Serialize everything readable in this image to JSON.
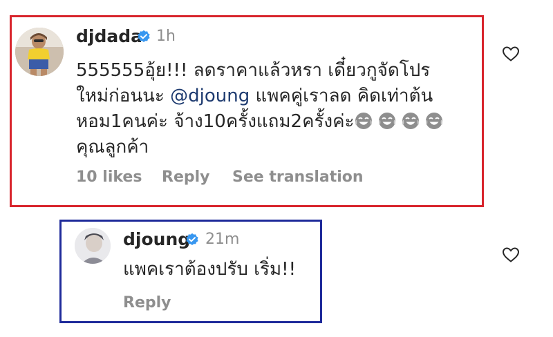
{
  "comments": [
    {
      "username": "djdada",
      "time": "1h",
      "verified": true,
      "text_line1": "555555อุ้ย!!! ลดราคาแล้วหรา เดี๋ยวกูจัดโปร",
      "text_line2_pre": "ใหม่ก่อนนะ ",
      "mention": "@djoung",
      "text_line2_post": " แพคคู่เราลด คิดเท่าต้น",
      "text_line3": "หอม1คนค่ะ จ้าง10ครั้งแถม2ครั้งค่ะ",
      "text_line4": "คุณลูกค้า",
      "emoji_icons": [
        "face-with-tears-of-joy-icon",
        "face-with-tears-of-joy-icon",
        "face-with-tears-of-joy-icon",
        "face-with-tears-of-joy-icon"
      ],
      "likes": "10 likes",
      "reply_label": "Reply",
      "translate_label": "See translation",
      "highlight_color": "#d8242c"
    },
    {
      "username": "djoung",
      "time": "21m",
      "verified": true,
      "text": "แพคเราต้องปรับ เริ่ม!!",
      "reply_label": "Reply",
      "highlight_color": "#1e2a9a"
    }
  ],
  "colors": {
    "verified": "#3897f0",
    "muted": "#8e8e8e",
    "mention": "#1e3b70"
  }
}
